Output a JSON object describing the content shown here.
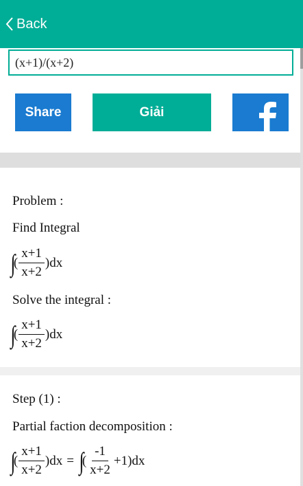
{
  "header": {
    "back_label": "Back",
    "accent_color": "#00ad96"
  },
  "input": {
    "value": "(x+1)/(x+2)"
  },
  "buttons": {
    "share_label": "Share",
    "solve_label": "Giải",
    "facebook_icon": "facebook-icon"
  },
  "card1": {
    "problem_label": "Problem :",
    "task_label": "Find Integral",
    "expr1": {
      "integral": "∫",
      "open": "(",
      "num": "x+1",
      "den": "x+2",
      "close": ")dx"
    },
    "solve_label": "Solve the integral :",
    "expr2": {
      "integral": "∫",
      "open": "(",
      "num": "x+1",
      "den": "x+2",
      "close": ")dx"
    }
  },
  "card2": {
    "step_label": "Step (1) :",
    "method_label": "Partial faction decomposition :",
    "expr": {
      "integral": "∫",
      "open": "(",
      "num": "x+1",
      "den": "x+2",
      "close": ")dx",
      "eq": "=",
      "integral2": "∫",
      "open2": "(",
      "num2": "-1",
      "den2": "x+2",
      "close2": "+1)dx"
    }
  }
}
